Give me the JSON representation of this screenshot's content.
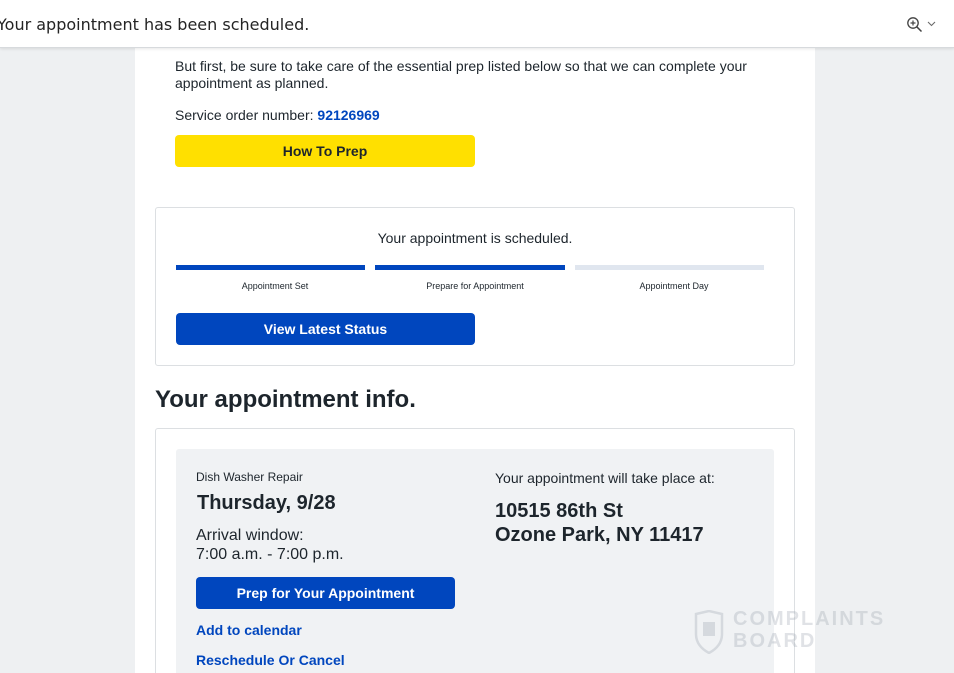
{
  "header": {
    "subject": "Your appointment has been scheduled.",
    "zoom_icon": "zoom-in-icon",
    "dropdown_icon": "chevron-down-icon"
  },
  "intro": {
    "text": "But first, be sure to take care of the essential prep listed below so that we can complete your appointment as planned.",
    "order_label": "Service order number: ",
    "order_number": "92126969",
    "prep_button": "How To Prep"
  },
  "status": {
    "message": "Your appointment is scheduled.",
    "steps": [
      {
        "label": "Appointment Set",
        "done": true
      },
      {
        "label": "Prepare for Appointment",
        "done": true
      },
      {
        "label": "Appointment Day",
        "done": false
      }
    ],
    "button": "View Latest Status"
  },
  "info": {
    "heading": "Your appointment info.",
    "service": "Dish Washer Repair",
    "date": "Thursday, 9/28",
    "arrival_label": "Arrival window:",
    "arrival_time": "7:00 a.m. - 7:00 p.m.",
    "prep_button": "Prep for Your Appointment",
    "calendar_link": "Add to calendar",
    "reschedule_link": "Reschedule Or Cancel",
    "place_label": "Your appointment will take place at:",
    "address_line1": "10515 86th St",
    "address_line2": "Ozone Park, NY 11417"
  },
  "watermark": {
    "line1": "COMPLAINTS",
    "line2": "BOARD"
  },
  "colors": {
    "accent_blue": "#0046be",
    "accent_yellow": "#ffe000",
    "progress_done": "#0046be",
    "progress_pending": "#e0e6ef"
  }
}
